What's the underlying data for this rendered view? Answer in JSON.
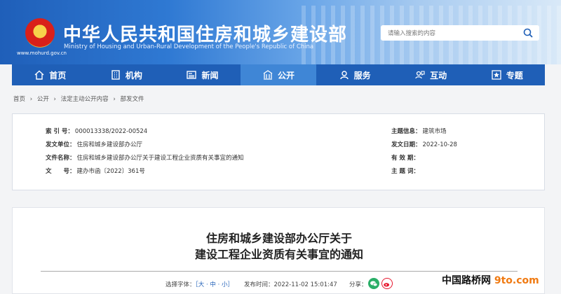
{
  "header": {
    "url": "www.mohurd.gov.cn",
    "title_cn": "中华人民共和国住房和城乡建设部",
    "title_en": "Ministry of Housing and Urban-Rural Development of the People's Republic of China",
    "search_placeholder": "请输入搜索的内容"
  },
  "nav": {
    "items": [
      {
        "label": "首页",
        "icon": "home-icon"
      },
      {
        "label": "机构",
        "icon": "building-icon"
      },
      {
        "label": "新闻",
        "icon": "news-icon"
      },
      {
        "label": "公开",
        "icon": "open-icon"
      },
      {
        "label": "服务",
        "icon": "service-icon"
      },
      {
        "label": "互动",
        "icon": "interact-icon"
      },
      {
        "label": "专题",
        "icon": "topic-icon"
      }
    ],
    "active_index": 3
  },
  "breadcrumb": [
    "首页",
    "›",
    "公开",
    "›",
    "法定主动公开内容",
    "›",
    "部发文件"
  ],
  "meta": {
    "index_no_label": "索 引 号：",
    "index_no": "000013338/2022-00524",
    "issuer_label": "发文单位：",
    "issuer": "住房和城乡建设部办公厅",
    "doc_name_label": "文件名称：",
    "doc_name": "住房和城乡建设部办公厅关于建设工程企业资质有关事宜的通知",
    "doc_no_label": "文　　号：",
    "doc_no": "建办市函〔2022〕361号",
    "topic_label": "主题信息：",
    "topic": "建筑市场",
    "date_label": "发文日期：",
    "date": "2022-10-28",
    "validity_label": "有 效 期：",
    "validity": "",
    "keywords_label": "主 题 词：",
    "keywords": ""
  },
  "article": {
    "title_line1": "住房和城乡建设部办公厅关于",
    "title_line2": "建设工程企业资质有关事宜的通知",
    "font_label": "选择字体：",
    "font_options": "［大 · 中 · 小］",
    "publish_label": "发布时间：",
    "publish_time": "2022-11-02 15:01:47",
    "share_label": "分享："
  },
  "watermark": {
    "text": "中国路桥网",
    "site": "9to.com"
  },
  "colors": {
    "nav": "#1f5fb7",
    "nav_active": "#3f86d6",
    "wechat": "#2aae67",
    "weibo": "#e6162d"
  }
}
